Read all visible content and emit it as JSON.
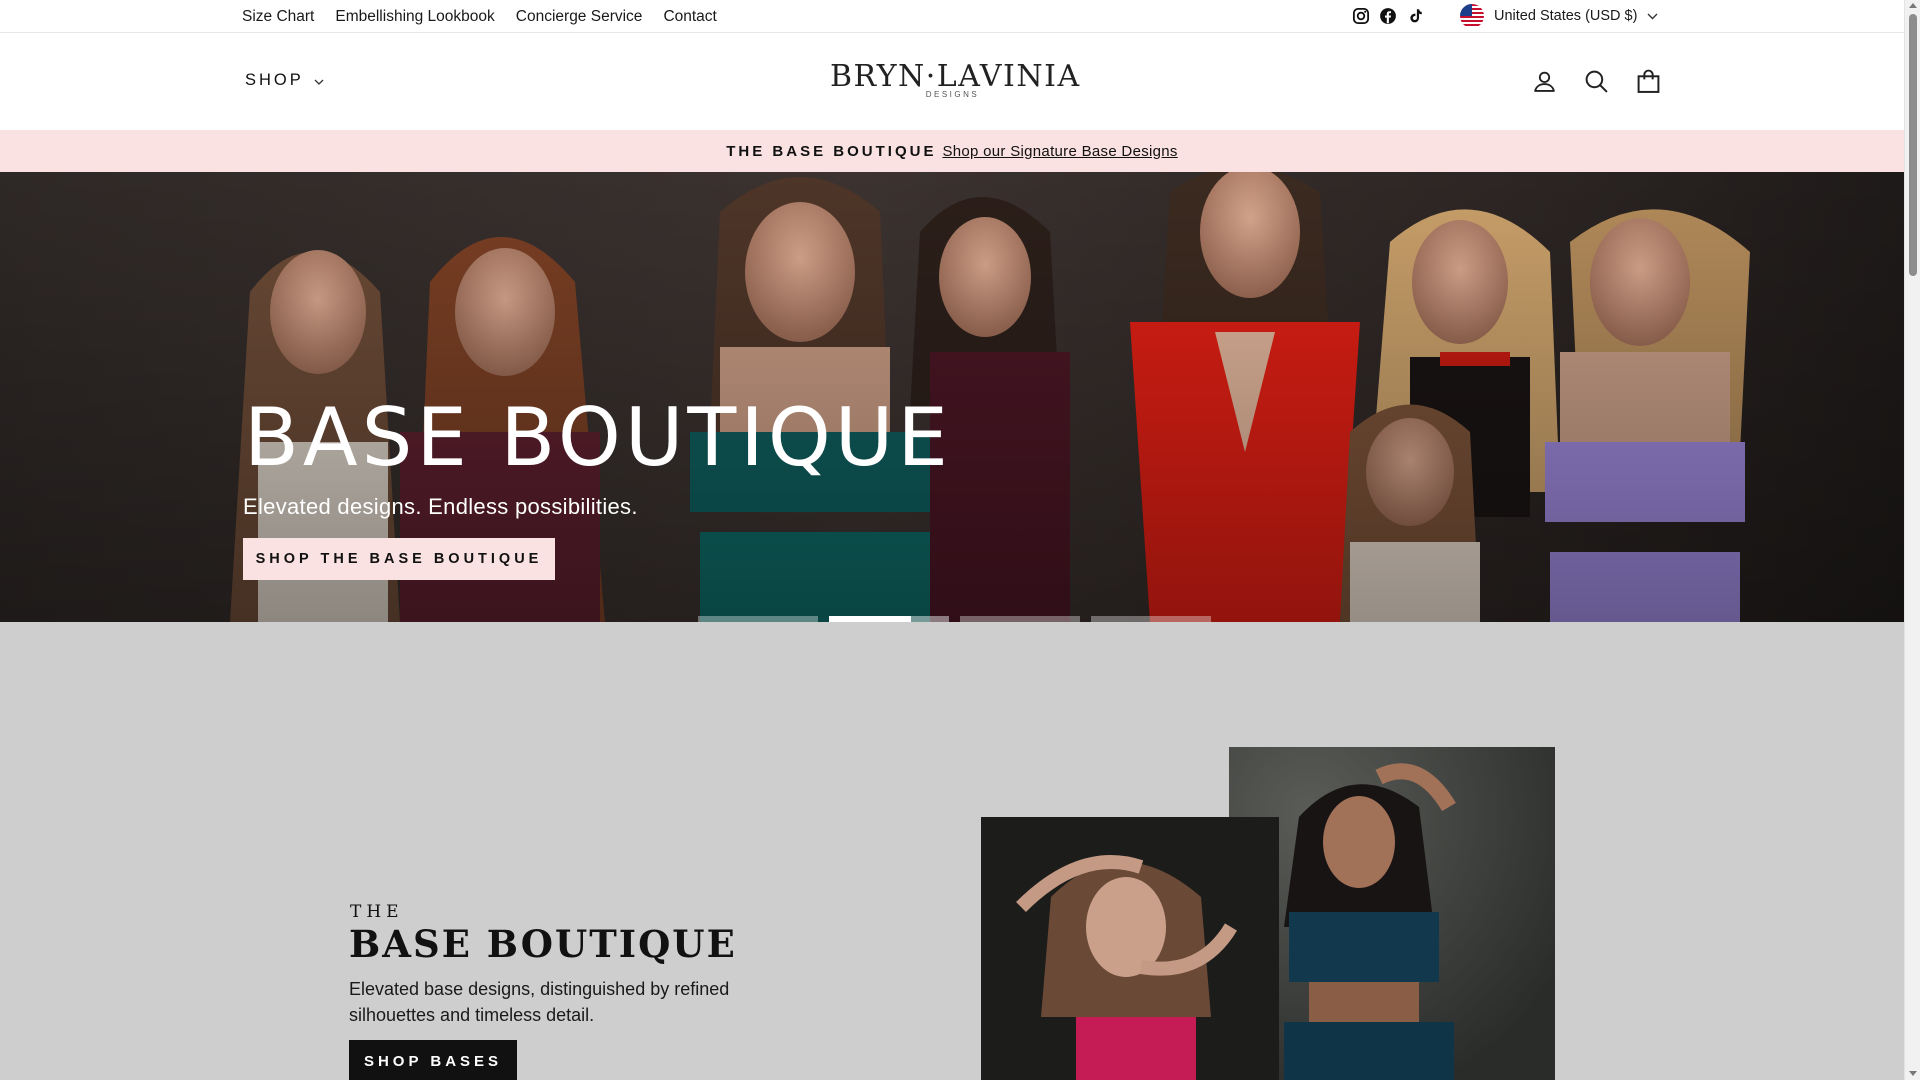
{
  "utility_bar": {
    "links": [
      "Size Chart",
      "Embellishing Lookbook",
      "Concierge Service",
      "Contact"
    ],
    "social_icons": [
      "instagram-icon",
      "facebook-icon",
      "tiktok-icon"
    ],
    "currency_label": "United States (USD $)",
    "flag_icon": "us-flag-icon"
  },
  "header": {
    "shop_label": "SHOP",
    "logo_name": "BRYN·LAVINIA",
    "logo_sub": "DESIGNS",
    "icons": [
      "account-icon",
      "search-icon",
      "cart-icon"
    ]
  },
  "announcement": {
    "strong": "THE BASE BOUTIQUE",
    "link": "Shop our Signature Base Designs"
  },
  "hero": {
    "title": "BASE BOUTIQUE",
    "subtitle": "Elevated designs. Endless possibilities.",
    "button": "SHOP THE BASE BOUTIQUE",
    "slides_count": 4,
    "active_slide": 2,
    "active_slide_progress": 0.68
  },
  "feature": {
    "pretitle": "THE",
    "title": "BASE BOUTIQUE",
    "text": "Elevated base designs, distinguished by refined silhouettes and timeless detail.",
    "button": "SHOP BASES"
  },
  "colors": {
    "announcement_bg": "#fbe2e2",
    "feature_bg": "#cecece",
    "button_dark": "#111111",
    "hero_text": "#ffffff"
  }
}
